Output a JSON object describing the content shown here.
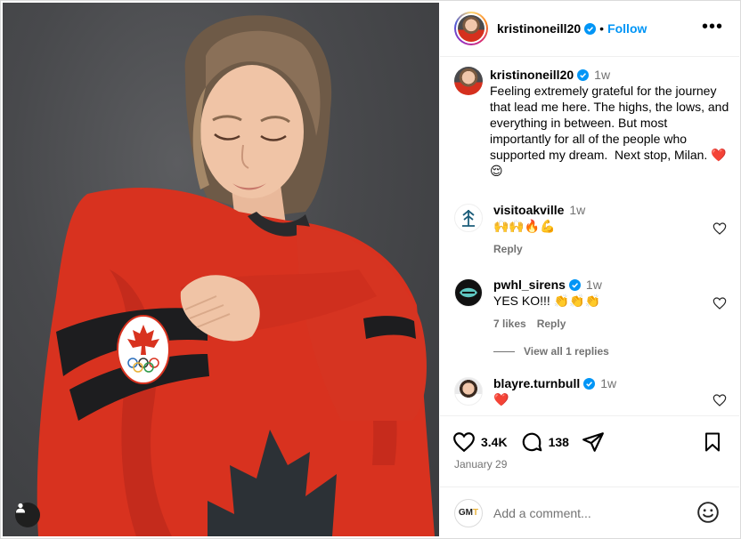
{
  "post": {
    "username": "kristinoneill20",
    "follow_label": "Follow",
    "more_label": "•••",
    "verified_icon": "verified-badge-icon"
  },
  "caption": {
    "username": "kristinoneill20",
    "time": "1w",
    "text": "Feeling extremely grateful for the journey that lead me here. The highs, the lows, and everything in between. But most importantly for all of the people who supported my dream.  Next stop, Milan. ❤️😌"
  },
  "comments": [
    {
      "username": "visitoakville",
      "time": "1w",
      "text": "🙌🙌🔥💪",
      "reply_label": "Reply",
      "likes": "",
      "verified": false
    },
    {
      "username": "pwhl_sirens",
      "time": "1w",
      "text": "YES KO!!! 👏👏👏",
      "likes": "7 likes",
      "reply_label": "Reply",
      "verified": true
    },
    {
      "username": "blayre.turnbull",
      "time": "1w",
      "text": "❤️",
      "reply_label": "",
      "likes": "",
      "verified": true
    }
  ],
  "view_replies_label": "View all 1 replies",
  "actions": {
    "likes_count": "3.4K",
    "comments_count": "138",
    "date": "January 29"
  },
  "add_comment": {
    "avatar_text": "GM",
    "avatar_text_accent": "T",
    "placeholder": "Add a comment..."
  },
  "colors": {
    "link_blue": "#0095f6",
    "muted": "#737373",
    "jersey_red": "#d5301e"
  }
}
